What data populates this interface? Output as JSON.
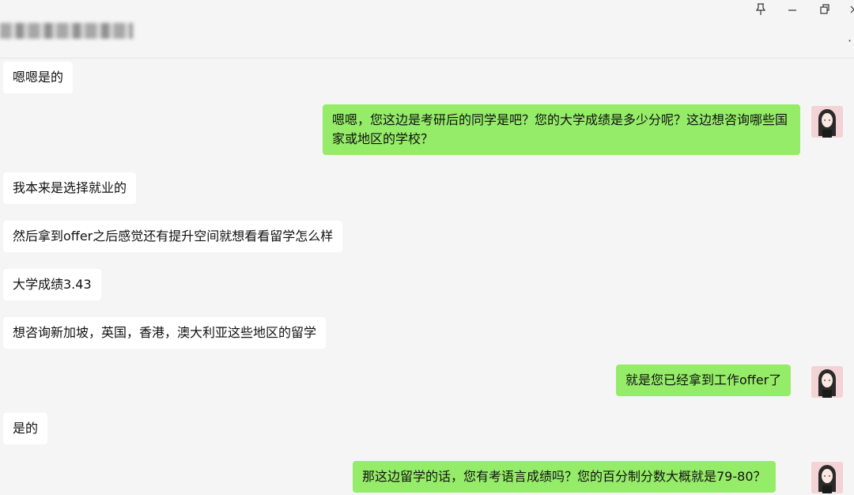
{
  "window": {
    "title_blurred": true,
    "controls": {
      "pin_icon": "pin-icon",
      "minimize_icon": "minimize-icon",
      "restore_icon": "restore-icon",
      "close_icon": "close-icon",
      "more_icon": "more-dots-icon"
    }
  },
  "messages": [
    {
      "side": "in",
      "text": "嗯嗯是的"
    },
    {
      "side": "out",
      "text": "嗯嗯，您这边是考研后的同学是吧？您的大学成绩是多少分呢？这边想咨询哪些国家或地区的学校？"
    },
    {
      "side": "in",
      "text": "我本来是选择就业的"
    },
    {
      "side": "in",
      "text": "然后拿到offer之后感觉还有提升空间就想看看留学怎么样"
    },
    {
      "side": "in",
      "text": "大学成绩3.43"
    },
    {
      "side": "in",
      "text": "想咨询新加坡，英国，香港，澳大利亚这些地区的留学"
    },
    {
      "side": "out",
      "text": "就是您已经拿到工作offer了"
    },
    {
      "side": "in",
      "text": "是的"
    },
    {
      "side": "out",
      "text": "那这边留学的话，您有考语言成绩吗？您的百分制分数大概就是79-80？"
    }
  ],
  "colors": {
    "incoming_bubble": "#ffffff",
    "outgoing_bubble": "#95ec69",
    "background": "#f5f5f5"
  }
}
